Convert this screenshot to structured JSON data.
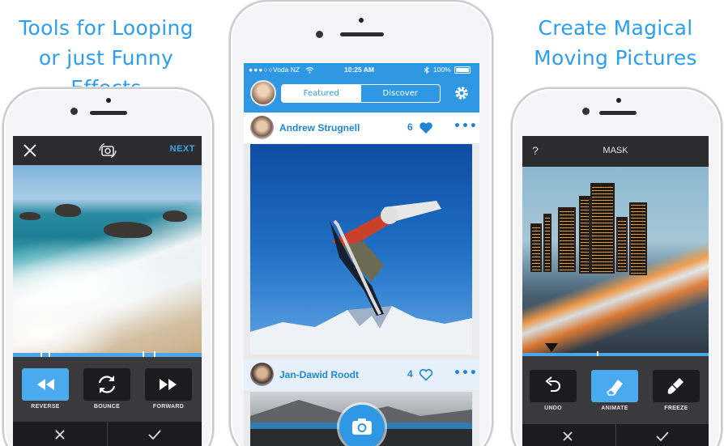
{
  "captions": {
    "left_line1": "Tools for Looping",
    "left_line2": "or just Funny Effects",
    "right_line1": "Create Magical",
    "right_line2": "Moving Pictures"
  },
  "left_phone": {
    "next_label": "NEXT",
    "controls": [
      {
        "label": "REVERSE",
        "icon": "rewind-icon",
        "active": true
      },
      {
        "label": "BOUNCE",
        "icon": "repeat-icon",
        "active": false
      },
      {
        "label": "FORWARD",
        "icon": "fast-forward-icon",
        "active": false
      }
    ]
  },
  "middle_phone": {
    "status": {
      "carrier": "Voda NZ",
      "time": "10:25 AM",
      "battery": "100%"
    },
    "tabs": {
      "featured": "Featured",
      "discover": "Discover"
    },
    "posts": [
      {
        "author": "Andrew Strugnell",
        "likes": "6",
        "liked": true
      },
      {
        "author": "Jan-Dawid Roodt",
        "likes": "4",
        "liked": false
      }
    ]
  },
  "right_phone": {
    "title": "MASK",
    "help": "?",
    "controls": [
      {
        "label": "UNDO",
        "icon": "undo-icon",
        "active": false
      },
      {
        "label": "ANIMATE",
        "icon": "eraser-icon",
        "active": true
      },
      {
        "label": "FREEZE",
        "icon": "brush-icon",
        "active": false
      }
    ]
  },
  "colors": {
    "accent": "#2f98e5",
    "caption": "#2a9ef0"
  }
}
